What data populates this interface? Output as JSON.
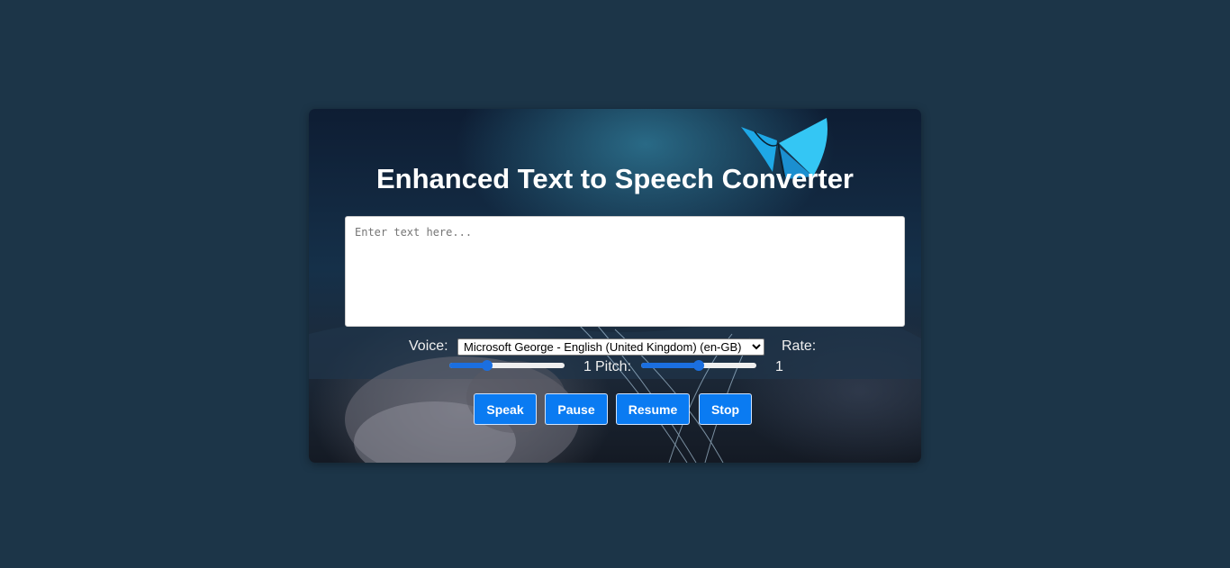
{
  "title": "Enhanced Text to Speech Converter",
  "textarea": {
    "placeholder": "Enter text here...",
    "value": ""
  },
  "voice": {
    "label": "Voice:",
    "selected": "Microsoft George - English (United Kingdom) (en-GB)"
  },
  "rate": {
    "label": "Rate:",
    "value": "1",
    "slider_fraction": 0.33
  },
  "pitch": {
    "label": "Pitch:",
    "value": "1",
    "slider_fraction": 0.5
  },
  "buttons": {
    "speak": "Speak",
    "pause": "Pause",
    "resume": "Resume",
    "stop": "Stop"
  },
  "colors": {
    "page_bg": "#1c3548",
    "button_bg": "#0a7bf2",
    "slider_accent": "#1b6fe0"
  },
  "icons": {
    "decoration": "butterfly-icon"
  }
}
